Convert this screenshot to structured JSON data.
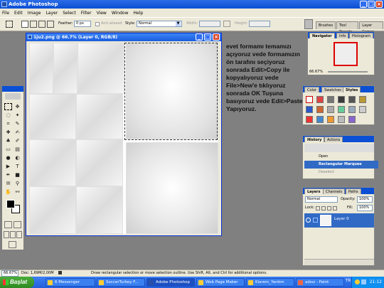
{
  "app": {
    "title": "Adobe Photoshop"
  },
  "menu": [
    "File",
    "Edit",
    "Image",
    "Layer",
    "Select",
    "Filter",
    "View",
    "Window",
    "Help"
  ],
  "options": {
    "feather_label": "Feather:",
    "feather_value": "0 px",
    "antialiased": "Anti-aliased",
    "style_label": "Style:",
    "style_value": "Normal",
    "width_label": "Width:",
    "height_label": "Height:"
  },
  "well_tabs": [
    "Brushes",
    "Tool Presets",
    "Layer Comps"
  ],
  "document": {
    "title": "1ju2.png @ 66.7% (Layer 0, RGB/8)"
  },
  "instructions": "evet formamı temamızı açıyoruz vede formamızın ön tarafını seçiyoruz sonrada Edit>Copy ile kopyalıyoruz vede File>New'e tıklıyoruz sonrada OK Tuşuna basıyoruz vede Edit>Paste Yapıyoruz.",
  "navigator": {
    "tabs": [
      "Navigator",
      "Info",
      "Histogram"
    ],
    "zoom": "66.67%"
  },
  "styles": {
    "tabs": [
      "Color",
      "Swatches",
      "Styles"
    ]
  },
  "history": {
    "tabs": [
      "History",
      "Actions"
    ],
    "items": [
      "Open",
      "Rectangular Marquee",
      "Deselect"
    ]
  },
  "layers": {
    "tabs": [
      "Layers",
      "Channels",
      "Paths"
    ],
    "blend": "Normal",
    "opacity_label": "Opacity:",
    "opacity_value": "100%",
    "lock_label": "Lock:",
    "fill_label": "Fill:",
    "fill_value": "100%",
    "layer_name": "Layer 0"
  },
  "status": {
    "zoom": "66.67%",
    "doc": "Doc: 1,69M/2,00M",
    "hint": "Draw rectangular selection or move selection outline.  Use Shift, Alt, and Ctrl for additional options."
  },
  "taskbar": {
    "start": "Başlat",
    "items": [
      "6 Messenger",
      "SoccerTurkey F...",
      "Adobe Photoshop",
      "Web Page Maker",
      "Kiarem_Yardım",
      "adsız - Paint"
    ],
    "lang": "TR",
    "clock": "21:12"
  },
  "colors": {
    "titlebar": "#0a4fd4",
    "taskbar": "#245edb",
    "start": "#2f8a22",
    "selected": "#316ac5"
  }
}
